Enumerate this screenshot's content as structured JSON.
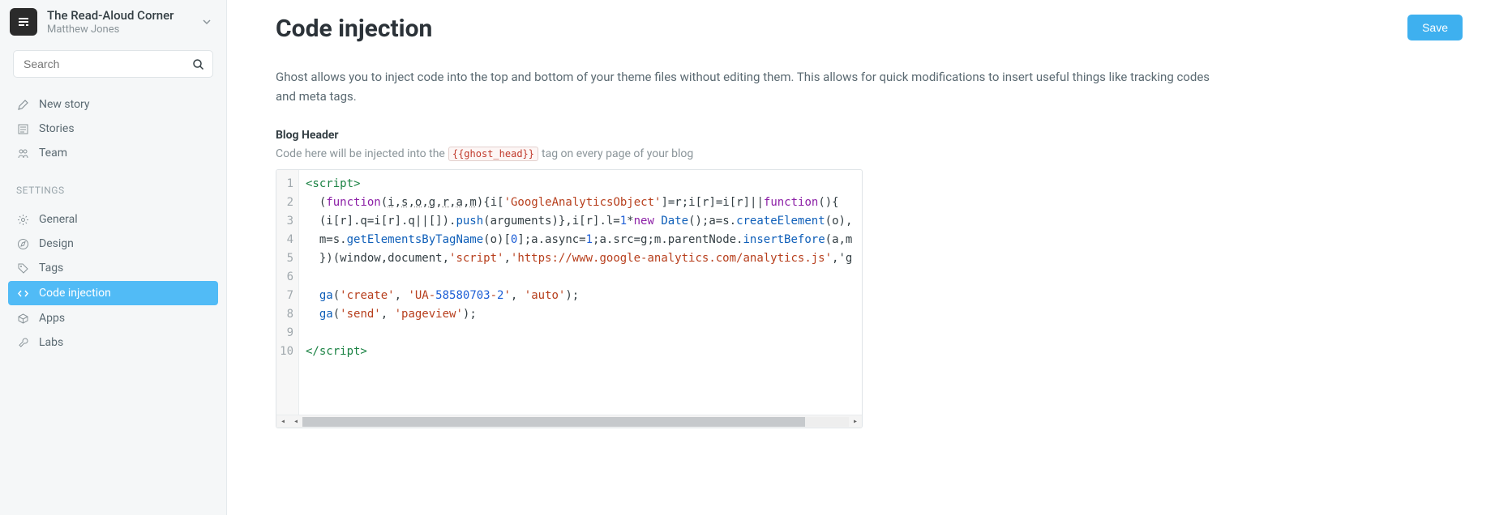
{
  "site": {
    "title": "The Read-Aloud Corner",
    "author": "Matthew Jones"
  },
  "search": {
    "placeholder": "Search"
  },
  "nav": {
    "items": [
      {
        "label": "New story"
      },
      {
        "label": "Stories"
      },
      {
        "label": "Team"
      }
    ],
    "settings_heading": "SETTINGS",
    "settings": [
      {
        "label": "General"
      },
      {
        "label": "Design"
      },
      {
        "label": "Tags"
      },
      {
        "label": "Code injection"
      },
      {
        "label": "Apps"
      },
      {
        "label": "Labs"
      }
    ]
  },
  "page": {
    "title": "Code injection",
    "save_label": "Save",
    "description": "Ghost allows you to inject code into the top and bottom of your theme files without editing them. This allows for quick modifications to insert useful things like tracking codes and meta tags.",
    "header_label": "Blog Header",
    "header_help_pre": "Code here will be injected into the",
    "header_help_tag": "{{ghost_head}}",
    "header_help_post": "tag on every page of your blog"
  },
  "code": {
    "line_count": 10,
    "lines": [
      "<script>",
      "  (function(i,s,o,g,r,a,m){i['GoogleAnalyticsObject']=r;i[r]=i[r]||function(){",
      "  (i[r].q=i[r].q||[]).push(arguments)},i[r].l=1*new Date();a=s.createElement(o),",
      "  m=s.getElementsByTagName(o)[0];a.async=1;a.src=g;m.parentNode.insertBefore(a,m",
      "  })(window,document,'script','https://www.google-analytics.com/analytics.js','g",
      "",
      "  ga('create', 'UA-58580703-2', 'auto');",
      "  ga('send', 'pageview');",
      "",
      "</script>"
    ]
  }
}
